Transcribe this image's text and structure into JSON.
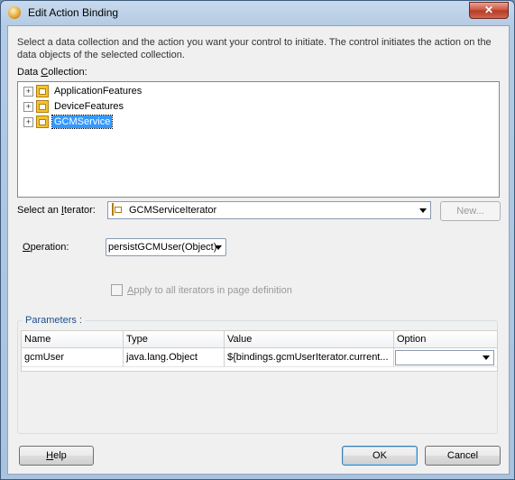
{
  "window": {
    "title": "Edit Action Binding",
    "close_glyph": "✕"
  },
  "description": "Select a data collection and the action you want your control to initiate. The control initiates the action on the data objects of the selected collection.",
  "data_collection": {
    "label_pre": "Data ",
    "label_accel": "C",
    "label_post": "ollection:",
    "items": [
      {
        "label": "ApplicationFeatures",
        "icon": "data-control-icon",
        "expander": "+",
        "selected": false
      },
      {
        "label": "DeviceFeatures",
        "icon": "data-control-icon",
        "expander": "+",
        "selected": false
      },
      {
        "label": "GCMService",
        "icon": "data-control-icon",
        "expander": "+",
        "selected": true
      }
    ]
  },
  "iterator": {
    "label_pre": "Select an ",
    "label_accel": "I",
    "label_post": "terator:",
    "value": "GCMServiceIterator",
    "new_button": "New..."
  },
  "operation": {
    "label_pre": "",
    "label_accel": "O",
    "label_post": "peration:",
    "value": "persistGCMUser(Object)"
  },
  "apply_all": {
    "label_accel": "A",
    "label_post": "pply to all iterators in page definition",
    "checked": false
  },
  "parameters": {
    "title": "Parameters :",
    "columns": [
      "Name",
      "Type",
      "Value",
      "Option"
    ],
    "rows": [
      {
        "name": "gcmUser",
        "type": "java.lang.Object",
        "value": "${bindings.gcmUserIterator.current...",
        "option": ""
      }
    ]
  },
  "buttons": {
    "help_accel": "H",
    "help_post": "elp",
    "ok": "OK",
    "cancel": "Cancel"
  },
  "colors": {
    "selection": "#3399ff",
    "group_title": "#1c4f8c",
    "close_button": "#c8503a"
  }
}
